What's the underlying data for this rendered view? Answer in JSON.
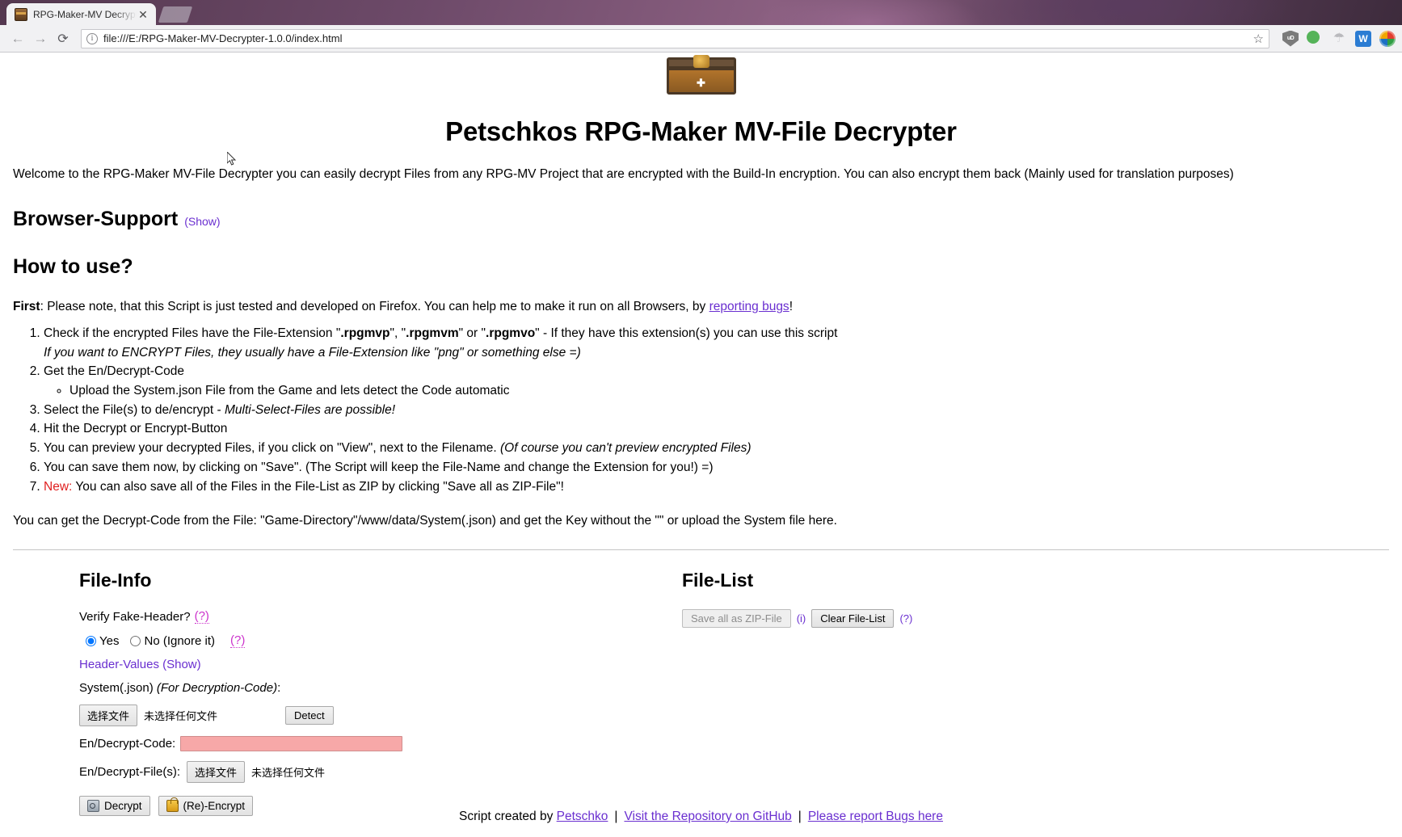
{
  "browser": {
    "tab": {
      "title": "RPG-Maker-MV Decrypter",
      "close_label": "✕",
      "favicon": "chest-favicon"
    },
    "newtab_label": "",
    "nav": {
      "back": "←",
      "forward": "→",
      "reload": "⟳"
    },
    "omnibox": {
      "info_glyph": "i",
      "url": "file:///E:/RPG-Maker-MV-Decrypter-1.0.0/index.html",
      "star": "☆"
    },
    "extensions": [
      {
        "name": "ublock-origin-icon",
        "label": "uD"
      },
      {
        "name": "green-status-icon",
        "label": ""
      },
      {
        "name": "parachute-icon",
        "label": "☂"
      },
      {
        "name": "word-extension-icon",
        "label": "W"
      },
      {
        "name": "globe-extension-icon",
        "label": ""
      }
    ]
  },
  "page": {
    "logo_alt": "treasure-chest",
    "title": "Petschkos RPG-Maker MV-File Decrypter",
    "intro": "Welcome to the RPG-Maker MV-File Decrypter you can easily decrypt Files from any RPG-MV Project that are encrypted with the Build-In encryption. You can also encrypt them back (Mainly used for translation purposes)",
    "browser_support": {
      "heading": "Browser-Support",
      "show_link": "(Show)"
    },
    "how_to_use_heading": "How to use?",
    "first_note": {
      "bold": "First",
      "text_before": ": Please note, that this Script is just tested and developed on Firefox. You can help me to make it run on all Browsers, by ",
      "link": "reporting bugs",
      "text_after": "!"
    },
    "steps": [
      {
        "prefix": "Check if the encrypted Files have the File-Extension \"",
        "ext1": ".rpgmvp",
        "mid1": "\", \"",
        "ext2": ".rpgmvm",
        "mid2": "\" or \"",
        "ext3": ".rpgmvo",
        "suffix": "\" - If they have this extension(s) you can use this script",
        "italic_note": "If you want to ENCRYPT Files, they usually have a File-Extension like \"png\" or something else =)"
      },
      {
        "text": "Get the En/Decrypt-Code",
        "sub": "Upload the System.json File from the Game and lets detect the Code automatic"
      },
      {
        "prefix": "Select the File(s) to de/encrypt - ",
        "italic": "Multi-Select-Files are possible!"
      },
      {
        "text": "Hit the Decrypt or Encrypt-Button"
      },
      {
        "prefix": "You can preview your decrypted Files, if you click on \"View\", next to the Filename. ",
        "italic": "(Of course you can't preview encrypted Files)"
      },
      {
        "text": "You can save them now, by clicking on \"Save\". (The Script will keep the File-Name and change the Extension for you!) =)"
      },
      {
        "new_tag": "New:",
        "text": " You can also save all of the Files in the File-List as ZIP by clicking \"Save all as ZIP-File\"!"
      }
    ],
    "decrypt_note": "You can get the Decrypt-Code from the File: \"Game-Directory\"/www/data/System(.json) and get the Key without the \"\" or upload the System file here.",
    "file_info": {
      "heading": "File-Info",
      "verify_label": "Verify Fake-Header?",
      "verify_help": "(?)",
      "radio_yes": "Yes",
      "radio_no": "No (Ignore it)",
      "radio_no_help": "(?)",
      "radio_selected": "yes",
      "header_values_link": "Header-Values (Show)",
      "system_label": "System(.json)",
      "system_label_italic": "(For Decryption-Code)",
      "system_label_colon": ":",
      "system_file_button": "选择文件",
      "system_file_status": "未选择任何文件",
      "detect_button": "Detect",
      "code_label": "En/Decrypt-Code:",
      "code_value": "",
      "code_bg": "#f7a8a8",
      "files_label": "En/Decrypt-File(s):",
      "files_button": "选择文件",
      "files_status": "未选择任何文件",
      "decrypt_button": "Decrypt",
      "encrypt_button": "(Re)-Encrypt"
    },
    "file_list": {
      "heading": "File-List",
      "save_zip_button": "Save all as ZIP-File",
      "info_link": "(i)",
      "clear_button": "Clear File-List",
      "clear_help": "(?)"
    },
    "footer": {
      "prefix": "Script created by ",
      "author_link": "Petschko",
      "sep1": "|",
      "repo_link": "Visit the Repository on GitHub",
      "sep2": "|",
      "bugs_link": "Please report Bugs here"
    }
  },
  "colors": {
    "link_purple": "#6a2fd0",
    "help_magenta": "#cc33cc",
    "new_red": "#e02020",
    "code_field_pink": "#f7a8a8"
  }
}
